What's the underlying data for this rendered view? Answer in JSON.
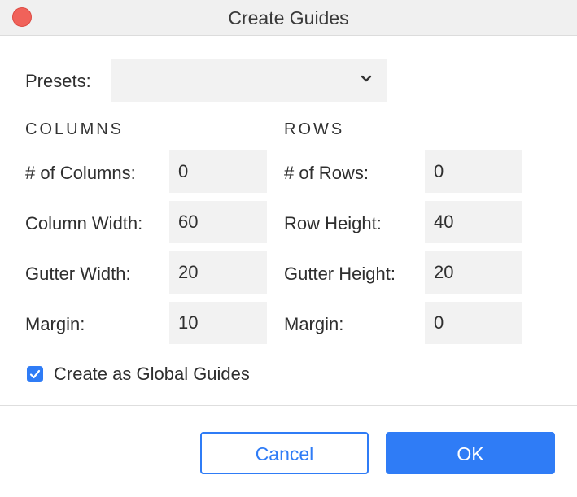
{
  "window": {
    "title": "Create Guides"
  },
  "presets": {
    "label": "Presets:",
    "value": ""
  },
  "columns": {
    "heading": "COLUMNS",
    "count_label": "# of Columns:",
    "count": "0",
    "width_label": "Column Width:",
    "width": "60",
    "gutter_label": "Gutter Width:",
    "gutter": "20",
    "margin_label": "Margin:",
    "margin": "10"
  },
  "rows": {
    "heading": "ROWS",
    "count_label": "# of Rows:",
    "count": "0",
    "height_label": "Row Height:",
    "height": "40",
    "gutter_label": "Gutter Height:",
    "gutter": "20",
    "margin_label": "Margin:",
    "margin": "0"
  },
  "global_guides": {
    "label": "Create as Global Guides",
    "checked": true
  },
  "buttons": {
    "cancel": "Cancel",
    "ok": "OK"
  },
  "colors": {
    "accent": "#2f7cf6",
    "close": "#f0625a",
    "field_bg": "#f2f2f2"
  }
}
